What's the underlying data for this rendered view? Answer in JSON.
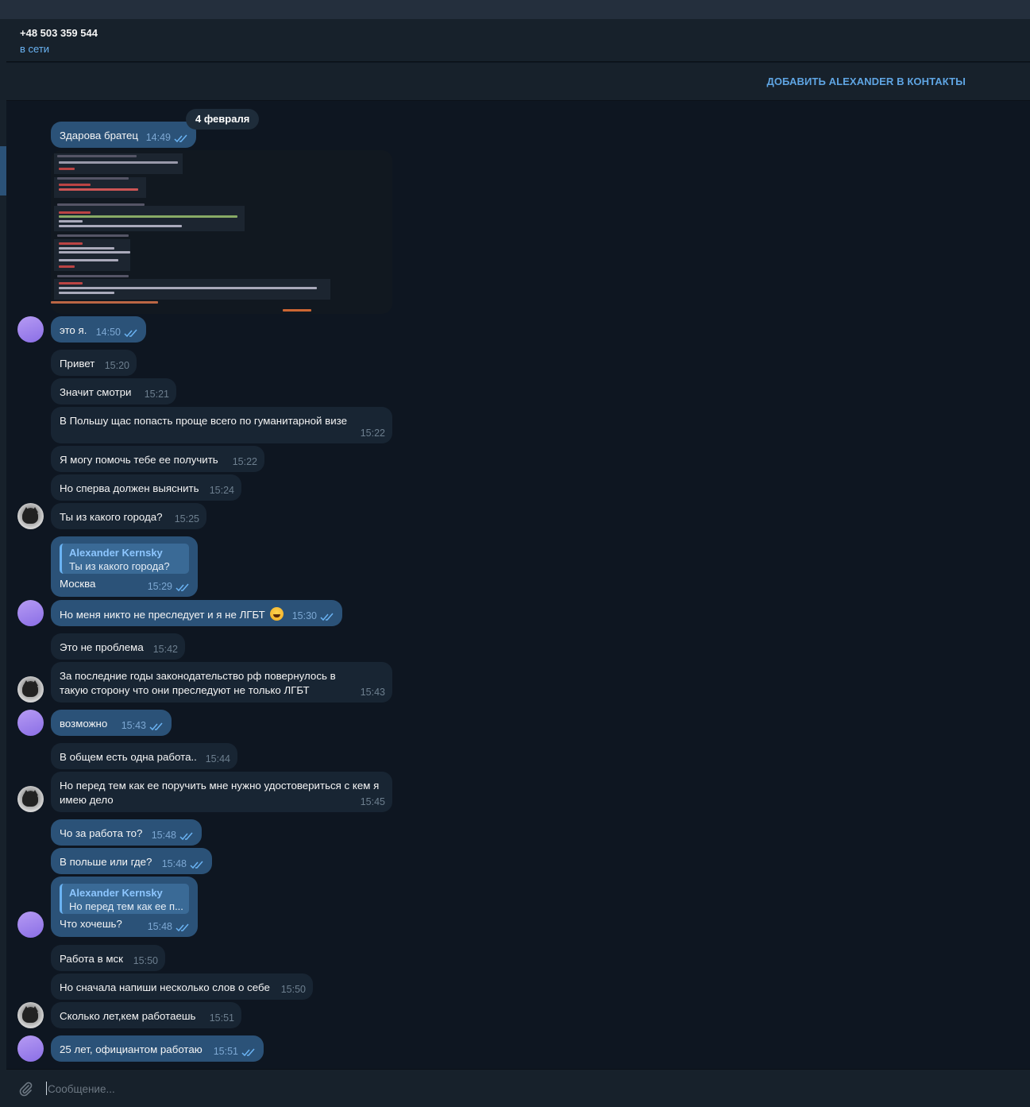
{
  "header": {
    "contact_phone": "+48 503 359 544",
    "status": "в сети"
  },
  "add_contact": {
    "label": "ДОБАВИТЬ ALEXANDER В КОНТАКТЫ"
  },
  "date_chip": "4 февраля",
  "messages": [
    {
      "dir": "out",
      "text": "Здарова братец",
      "time": "14:49"
    },
    {
      "dir": "out",
      "type": "image",
      "caption": "screenshot of forum thread"
    },
    {
      "dir": "out",
      "text": "это я.",
      "time": "14:50"
    },
    {
      "dir": "in",
      "text": "Привет",
      "time": "15:20"
    },
    {
      "dir": "in",
      "text": "Значит смотри",
      "time": "15:21"
    },
    {
      "dir": "in",
      "text": "В Польшу щас попасть проще всего по гуманитарной визе",
      "time": "15:22"
    },
    {
      "dir": "in",
      "text": "Я могу помочь тебе ее получить",
      "time": "15:22"
    },
    {
      "dir": "in",
      "text": "Но сперва должен выяснить",
      "time": "15:24"
    },
    {
      "dir": "in",
      "text": "Ты из какого города?",
      "time": "15:25"
    },
    {
      "dir": "out",
      "reply_name": "Alexander Kernsky",
      "reply_text": "Ты из какого города?",
      "text": "Москва",
      "time": "15:29"
    },
    {
      "dir": "out",
      "text": "Но меня никто не преследует и я не ЛГБТ",
      "emoji": "joy-emoji",
      "time": "15:30"
    },
    {
      "dir": "in",
      "text": "Это не проблема",
      "time": "15:42"
    },
    {
      "dir": "in",
      "text": "За последние годы законодательство рф повернулось в такую сторону что они преследуют не только ЛГБТ",
      "time": "15:43"
    },
    {
      "dir": "out",
      "text": "возможно",
      "time": "15:43"
    },
    {
      "dir": "in",
      "text": "В общем есть одна работа..",
      "time": "15:44"
    },
    {
      "dir": "in",
      "text": "Но перед тем как ее поручить мне нужно удостовериться с кем я имею дело",
      "time": "15:45"
    },
    {
      "dir": "out",
      "text": "Чо за работа то?",
      "time": "15:48"
    },
    {
      "dir": "out",
      "text": "В польше или где?",
      "time": "15:48"
    },
    {
      "dir": "out",
      "reply_name": "Alexander Kernsky",
      "reply_text": "Но перед тем как ее п...",
      "text": "Что хочешь?",
      "time": "15:48"
    },
    {
      "dir": "in",
      "text": "Работа в мск",
      "time": "15:50"
    },
    {
      "dir": "in",
      "text": "Но сначала напиши несколько слов о себе",
      "time": "15:50"
    },
    {
      "dir": "in",
      "text": "Сколько лет,кем работаешь",
      "time": "15:51"
    },
    {
      "dir": "out",
      "text": "25 лет, официантом работаю",
      "time": "15:51"
    }
  ],
  "composer": {
    "placeholder": "Сообщение..."
  },
  "colors": {
    "background": "#0e1621",
    "panel": "#17212b",
    "bubble_in": "#182533",
    "bubble_out": "#2b5278",
    "accent": "#6ab3f3"
  }
}
